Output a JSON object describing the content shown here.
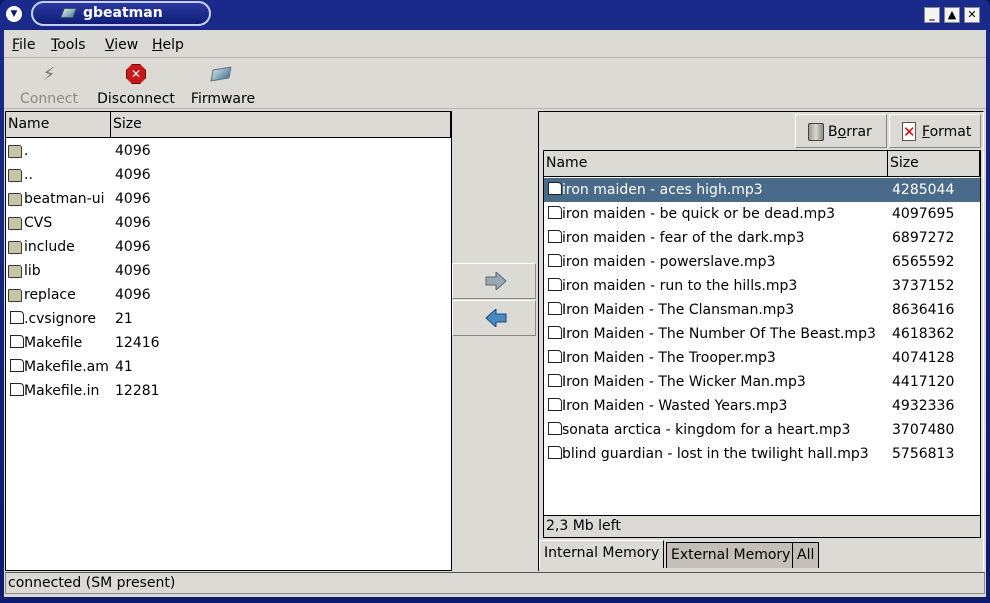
{
  "window": {
    "title": "gbeatman",
    "controls": [
      "minimize",
      "maximize",
      "close"
    ]
  },
  "menubar": {
    "items": [
      {
        "label": "File",
        "mnemonic": "F",
        "rest": "ile"
      },
      {
        "label": "Tools",
        "mnemonic": "T",
        "rest": "ools"
      },
      {
        "label": "View",
        "mnemonic": "V",
        "rest": "iew"
      },
      {
        "label": "Help",
        "mnemonic": "H",
        "rest": "elp"
      }
    ]
  },
  "toolbar": {
    "connect": {
      "label": "Connect",
      "icon": "plug-icon",
      "enabled": false
    },
    "disconnect": {
      "label": "Disconnect",
      "icon": "stop-icon",
      "enabled": true
    },
    "firmware": {
      "label": "Firmware",
      "icon": "firmware-chip-icon",
      "enabled": true
    }
  },
  "local_files": {
    "columns": [
      "Name",
      "Size"
    ],
    "rows": [
      {
        "type": "folder",
        "name": ".",
        "size": "4096"
      },
      {
        "type": "folder",
        "name": "..",
        "size": "4096"
      },
      {
        "type": "folder",
        "name": "beatman-ui",
        "size": "4096"
      },
      {
        "type": "folder",
        "name": "CVS",
        "size": "4096"
      },
      {
        "type": "folder",
        "name": "include",
        "size": "4096"
      },
      {
        "type": "folder",
        "name": "lib",
        "size": "4096"
      },
      {
        "type": "folder",
        "name": "replace",
        "size": "4096"
      },
      {
        "type": "file",
        "name": ".cvsignore",
        "size": "21"
      },
      {
        "type": "file",
        "name": "Makefile",
        "size": "12416"
      },
      {
        "type": "file",
        "name": "Makefile.am",
        "size": "41"
      },
      {
        "type": "file",
        "name": "Makefile.in",
        "size": "12281"
      }
    ]
  },
  "transfer": {
    "upload_icon": "arrow-right-icon",
    "download_icon": "arrow-left-icon"
  },
  "device": {
    "actions": {
      "delete": {
        "label": "Borrar",
        "pre": "B",
        "mnemonic": "o",
        "post": "rrar"
      },
      "format": {
        "label": "Format",
        "mnemonic": "F",
        "post": "ormat"
      }
    },
    "columns": [
      "Name",
      "Size"
    ],
    "selected_index": 0,
    "rows": [
      {
        "name": "iron maiden - aces high.mp3",
        "size": "4285044"
      },
      {
        "name": "iron maiden - be quick or be dead.mp3",
        "size": "4097695"
      },
      {
        "name": "iron maiden - fear of the dark.mp3",
        "size": "6897272"
      },
      {
        "name": "iron maiden - powerslave.mp3",
        "size": "6565592"
      },
      {
        "name": "iron maiden - run to the hills.mp3",
        "size": "3737152"
      },
      {
        "name": "Iron Maiden - The Clansman.mp3",
        "size": "8636416"
      },
      {
        "name": "Iron Maiden - The Number Of The Beast.mp3",
        "size": "4618362"
      },
      {
        "name": "Iron Maiden - The Trooper.mp3",
        "size": "4074128"
      },
      {
        "name": "Iron Maiden - The Wicker Man.mp3",
        "size": "4417120"
      },
      {
        "name": "Iron Maiden - Wasted Years.mp3",
        "size": "4932336"
      },
      {
        "name": "sonata arctica - kingdom for a heart.mp3",
        "size": "3707480"
      },
      {
        "name": "blind guardian - lost in the twilight hall.mp3",
        "size": "5756813"
      }
    ],
    "free_space": "2,3 Mb left",
    "tabs": [
      {
        "label": "Internal Memory",
        "active": true
      },
      {
        "label": "External Memory",
        "active": false
      },
      {
        "label": "All",
        "active": false
      }
    ]
  },
  "status": {
    "text": "connected (SM present)"
  },
  "colors": {
    "titlebar": "#0e1c6e",
    "selection": "#4a6a8a",
    "chrome": "#dcdad5"
  }
}
